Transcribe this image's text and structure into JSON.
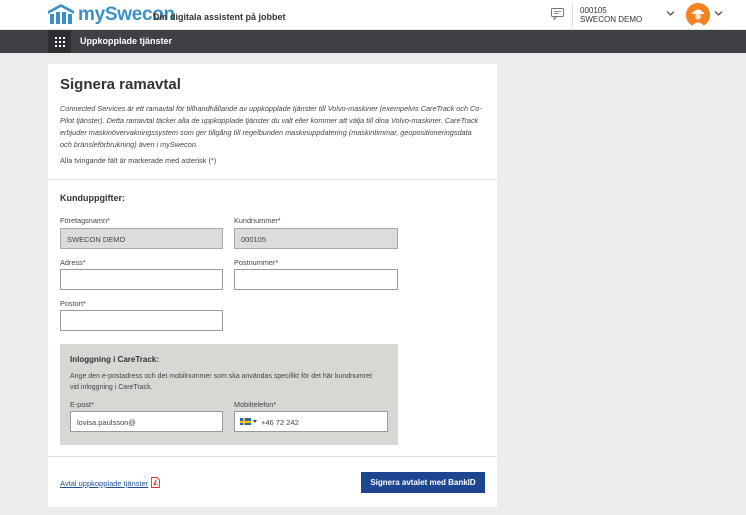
{
  "header": {
    "logo_text": "mySwecon",
    "tagline": "Din digitala assistent på jobbet",
    "company_id": "000105",
    "company_name": "SWECON DEMO",
    "icons": [
      "logo-icon",
      "chat-icon",
      "chevron-down-icon",
      "avatar-icon"
    ]
  },
  "nav": {
    "title": "Uppkopplade tjänster",
    "menu_icon": "grid-icon"
  },
  "form": {
    "title": "Signera ramavtal",
    "intro": "Connected Services är ett ramavtal för tillhandhållande av uppkopplade tjänster till Volvo-maskiner (exempelvis CareTrack och Co-Pilot tjänster). Detta ramavtal täcker alla de uppkopplade tjänster du valt eller kommer att välja till dina Volvo-maskiner. CareTrack erbjuder maskinövervakningssystem som ger tillgång till regelbunden maskinuppdatering (maskintimmar, geopositioneringsdata och bränsleförbrukning) även i mySwecon.",
    "required_note": "Alla tvingande fält är markerade med asterisk (*)",
    "section_title": "Kunduppgifter:",
    "fields": {
      "company_name": {
        "label": "Företagsnamn*",
        "value": "SWECON DEMO"
      },
      "customer_number": {
        "label": "Kundnummer*",
        "value": "000105"
      },
      "address": {
        "label": "Adress*",
        "value": ""
      },
      "postal_code": {
        "label": "Postnummer*",
        "value": ""
      },
      "city": {
        "label": "Postort*",
        "value": ""
      }
    },
    "caretrack": {
      "title": "Inloggning i CareTrack:",
      "description": "Ange den e-postadress och det mobilnummer som ska användas specifikt för det här kundnumret vid inloggning i CareTrack.",
      "email": {
        "label": "E-post*",
        "value": "lovisa.paulsson@"
      },
      "phone": {
        "label": "Mobiltelefon*",
        "value": "+46 72 242",
        "country_icon": "sweden-flag-icon"
      }
    },
    "footer": {
      "agreement_link": "Avtal uppkopplade tjänster",
      "pdf_icon": "pdf-icon",
      "submit_label": "Signera avtalet med BankID"
    }
  },
  "colors": {
    "brand_blue": "#3b8fc4",
    "nav_bg": "#3e4045",
    "button_blue": "#1e4590",
    "avatar_orange": "#f58220",
    "link_blue": "#1f4e96"
  }
}
